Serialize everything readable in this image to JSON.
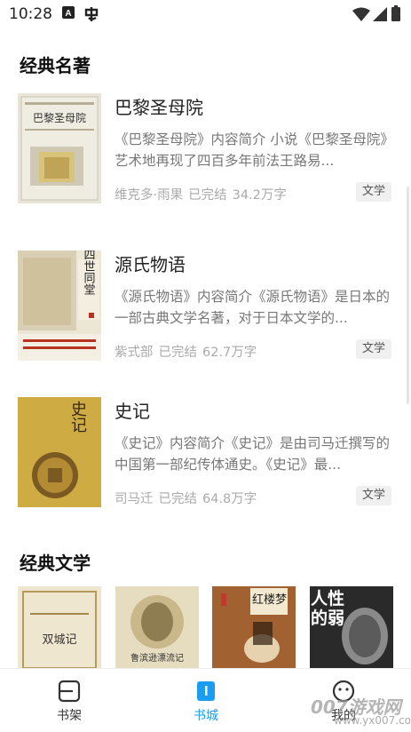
{
  "status_bar": {
    "time": "10:28"
  },
  "section1": {
    "title": "经典名著"
  },
  "books": [
    {
      "title": "巴黎圣母院",
      "desc": "《巴黎圣母院》内容简介 小说《巴黎圣母院》艺术地再现了四百多年前法王路易...",
      "author": "维克多·雨果",
      "status": "已完结",
      "words": "34.2万字",
      "tag": "文学",
      "cover_text": "巴黎圣母院"
    },
    {
      "title": "源氏物语",
      "desc": "《源氏物语》内容简介《源氏物语》是日本的一部古典文学名著，对于日本文学的...",
      "author": "紫式部",
      "status": "已完结",
      "words": "62.7万字",
      "tag": "文学",
      "cover_text": "四世同堂"
    },
    {
      "title": "史记",
      "desc": "《史记》内容简介《史记》是由司马迁撰写的中国第一部纪传体通史。《史记》最...",
      "author": "司马迁",
      "status": "已完结",
      "words": "64.8万字",
      "tag": "文学",
      "cover_text": "史记"
    }
  ],
  "section2": {
    "title": "经典文学"
  },
  "thumbs": [
    {
      "cover_text": "双城记"
    },
    {
      "cover_text": "鲁滨逊漂流记"
    },
    {
      "cover_text": ""
    },
    {
      "cover_text": "红楼梦"
    },
    {
      "cover_text": "人性的弱"
    }
  ],
  "nav": {
    "items": [
      {
        "label": "书架",
        "icon": "bookshelf-icon"
      },
      {
        "label": "书城",
        "icon": "bookstore-icon",
        "active": true
      },
      {
        "label": "我的",
        "icon": "profile-icon"
      }
    ],
    "active_color": "#1a9cf0"
  },
  "watermark": {
    "text": "007游戏网",
    "sub": "www.yx007.com"
  }
}
